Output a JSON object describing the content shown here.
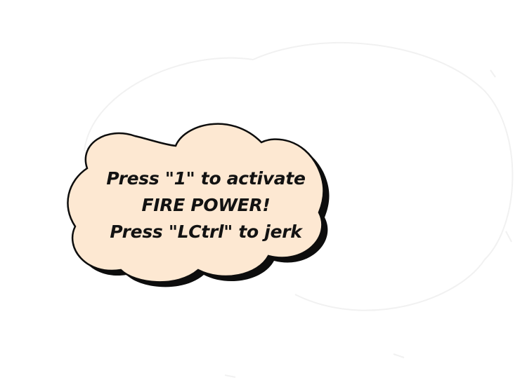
{
  "tutorial_bubble": {
    "line1": "Press \"1\" to activate",
    "line2": "FIRE POWER!",
    "line3": "Press \"LCtrl\" to jerk"
  },
  "colors": {
    "background": "#ffffff",
    "bubble_fill": "#fde8d2",
    "bubble_outline": "#0d0d0d",
    "text": "#121212"
  }
}
